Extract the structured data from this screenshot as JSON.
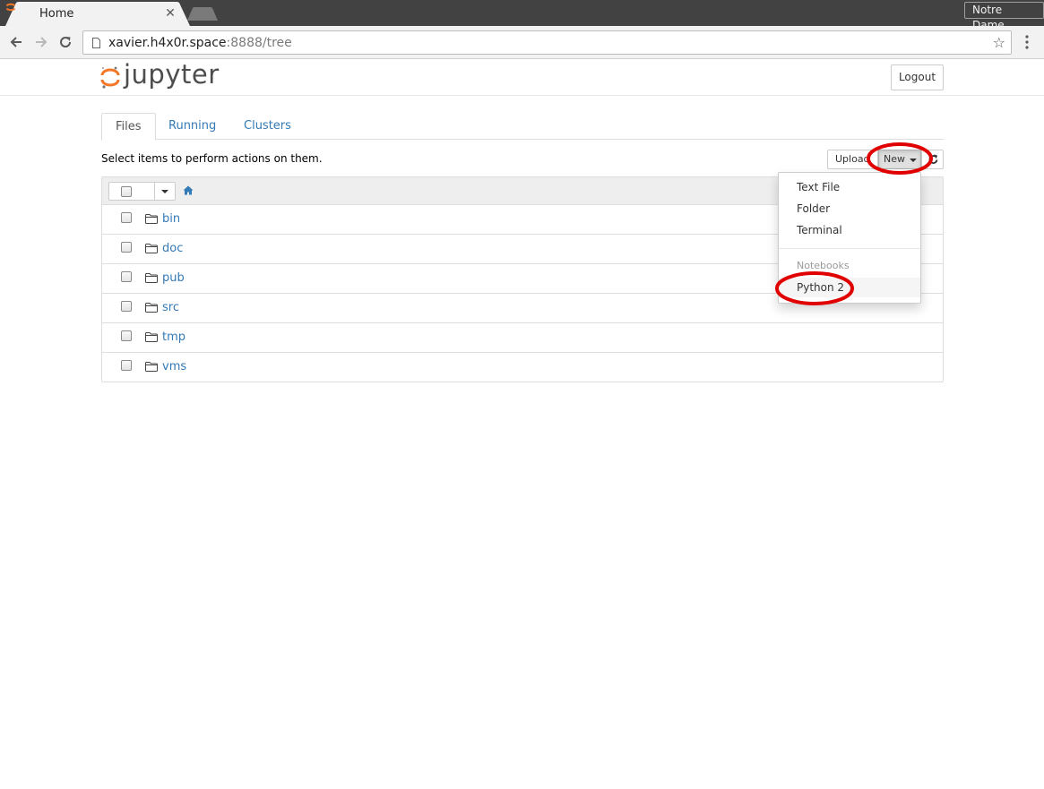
{
  "browser": {
    "tab_title": "Home",
    "tab_close_glyph": "✕",
    "profile_name": "Notre Dame",
    "url_host": "xavier.h4x0r.space",
    "url_path": ":8888/tree",
    "bookmark_glyph": "☆"
  },
  "header": {
    "logo_text": "jupyter",
    "logout_label": "Logout"
  },
  "tabs": [
    {
      "label": "Files",
      "active": true
    },
    {
      "label": "Running",
      "active": false
    },
    {
      "label": "Clusters",
      "active": false
    }
  ],
  "toolbar": {
    "instructions": "Select items to perform actions on them.",
    "upload_label": "Upload",
    "new_label": "New"
  },
  "files": [
    {
      "name": "bin",
      "type": "folder"
    },
    {
      "name": "doc",
      "type": "folder"
    },
    {
      "name": "pub",
      "type": "folder"
    },
    {
      "name": "src",
      "type": "folder"
    },
    {
      "name": "tmp",
      "type": "folder"
    },
    {
      "name": "vms",
      "type": "folder"
    }
  ],
  "new_menu": {
    "items": [
      "Text File",
      "Folder",
      "Terminal"
    ],
    "notebooks_header": "Notebooks",
    "notebook_kernels": [
      "Python 2"
    ]
  },
  "icons": {
    "favicon": "jupyter-logo-icon",
    "back": "arrow-left-icon",
    "forward": "arrow-right-icon",
    "reload": "reload-icon",
    "home": "home-icon",
    "folder": "folder-icon",
    "refresh": "refresh-icon",
    "menu": "kebab-menu-icon"
  },
  "colors": {
    "link": "#337ab7",
    "jupyter_orange": "#f37726",
    "annotation_red": "#e00000",
    "chrome_dark": "#424242"
  }
}
